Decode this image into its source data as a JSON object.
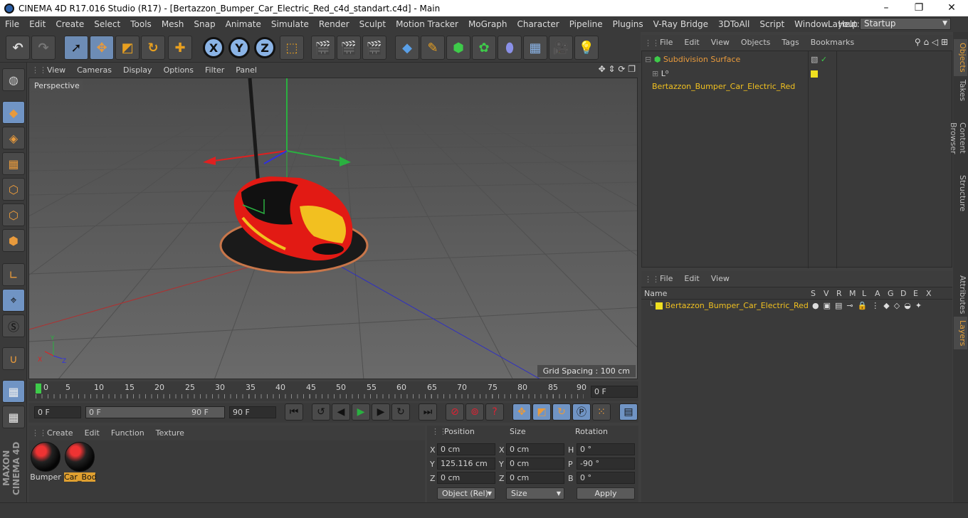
{
  "window": {
    "title": "CINEMA 4D R17.016 Studio (R17) - [Bertazzon_Bumper_Car_Electric_Red_c4d_standart.c4d] - Main"
  },
  "menu": [
    "File",
    "Edit",
    "Create",
    "Select",
    "Tools",
    "Mesh",
    "Snap",
    "Animate",
    "Simulate",
    "Render",
    "Sculpt",
    "Motion Tracker",
    "MoGraph",
    "Character",
    "Pipeline",
    "Plugins",
    "V-Ray Bridge",
    "3DToAll",
    "Script",
    "Window",
    "Help"
  ],
  "layout": {
    "label": "Layout:",
    "value": "Startup"
  },
  "viewport": {
    "menu": [
      "View",
      "Cameras",
      "Display",
      "Options",
      "Filter",
      "Panel"
    ],
    "label": "Perspective",
    "grid_spacing": "Grid Spacing : 100 cm"
  },
  "timeline": {
    "ticks": [
      "0",
      "5",
      "10",
      "15",
      "20",
      "25",
      "30",
      "35",
      "40",
      "45",
      "50",
      "55",
      "60",
      "65",
      "70",
      "75",
      "80",
      "85",
      "90"
    ],
    "current_frame": "0 F"
  },
  "playback": {
    "start": "0 F",
    "range_start": "0 F",
    "range_end": "90 F",
    "end": "90 F"
  },
  "materials": {
    "menu": [
      "Create",
      "Edit",
      "Function",
      "Texture"
    ],
    "items": [
      {
        "name": "Bumper"
      },
      {
        "name": "Car_Bod"
      }
    ]
  },
  "coordinates": {
    "headers": {
      "position": "Position",
      "size": "Size",
      "rotation": "Rotation"
    },
    "rows": [
      {
        "axis": "X",
        "pos": "0 cm",
        "size_axis": "X",
        "size": "0 cm",
        "rot_axis": "H",
        "rot": "0 °"
      },
      {
        "axis": "Y",
        "pos": "125.116 cm",
        "size_axis": "Y",
        "size": "0 cm",
        "rot_axis": "P",
        "rot": "-90 °"
      },
      {
        "axis": "Z",
        "pos": "0 cm",
        "size_axis": "Z",
        "size": "0 cm",
        "rot_axis": "B",
        "rot": "0 °"
      }
    ],
    "mode": "Object (Rel)",
    "size_mode": "Size",
    "apply": "Apply"
  },
  "objects": {
    "menu": [
      "File",
      "Edit",
      "View",
      "Objects",
      "Tags",
      "Bookmarks"
    ],
    "items": [
      {
        "name": "Subdivision Surface"
      },
      {
        "name": "Bertazzon_Bumper_Car_Electric_Red"
      }
    ]
  },
  "layers": {
    "menu": [
      "File",
      "Edit",
      "View"
    ],
    "columns": [
      "Name",
      "S",
      "V",
      "R",
      "M",
      "L",
      "A",
      "G",
      "D",
      "E",
      "X"
    ],
    "items": [
      {
        "name": "Bertazzon_Bumper_Car_Electric_Red"
      }
    ]
  },
  "side_tabs": [
    "Objects",
    "Takes",
    "Content Browser",
    "Structure",
    "Attributes",
    "Layers"
  ],
  "brand": "MAXON CINEMA 4D",
  "colors": {
    "accent": "#e89a3c",
    "selected": "#7094c4",
    "layer": "#f0e020"
  }
}
